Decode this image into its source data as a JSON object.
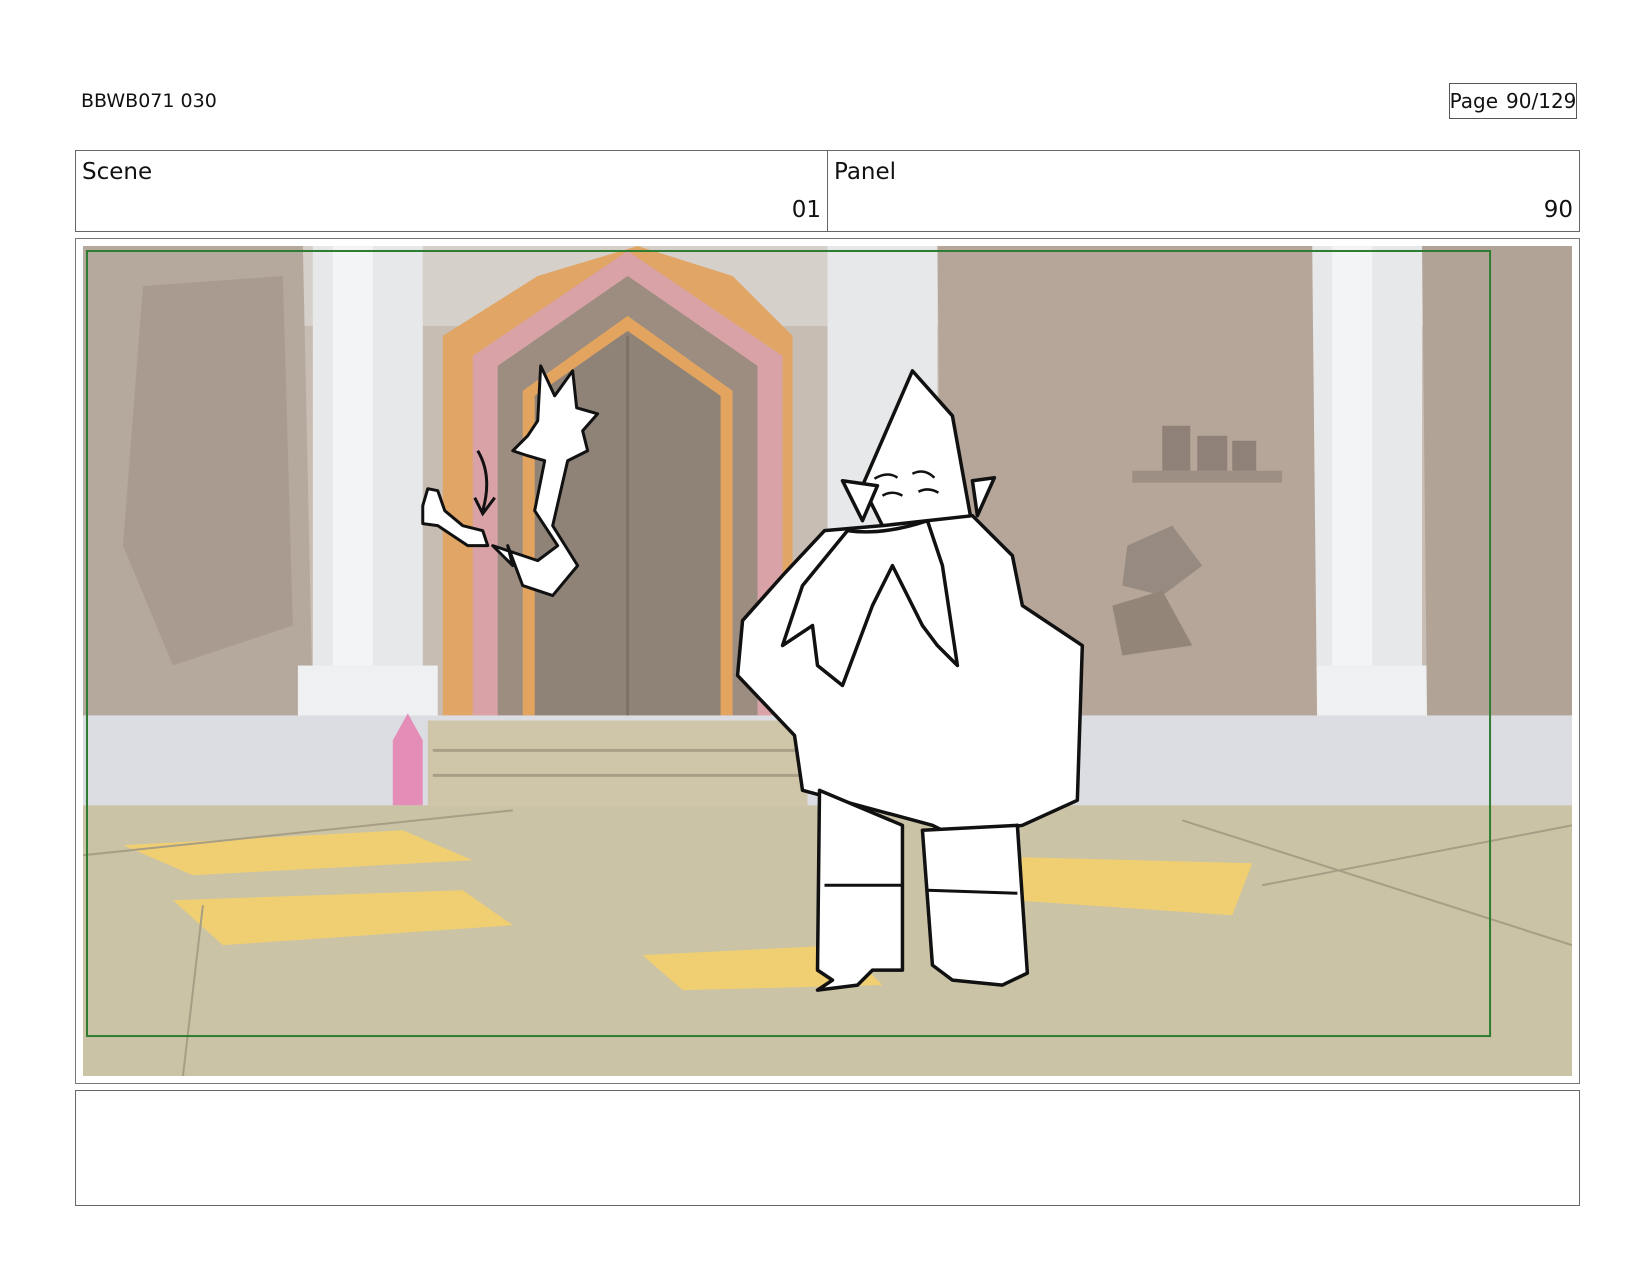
{
  "header": {
    "code": "BBWB071 030",
    "page_label": "Page",
    "page_value": "90/129"
  },
  "scene": {
    "label": "Scene",
    "value": "01"
  },
  "panel": {
    "label": "Panel",
    "value": "90"
  },
  "notes": {
    "text": ""
  },
  "colors": {
    "safe_frame": "#2e7d32",
    "floor": "#cbc3a6",
    "floor_highlight": "#f1cf6a",
    "wall": "#b9aea3",
    "pillar": "#e8eaec",
    "doorway_outer": "#d9a3a8",
    "doorway_orange": "#e0a262",
    "door": "#8e8277",
    "crystal": "#e08bb3"
  }
}
